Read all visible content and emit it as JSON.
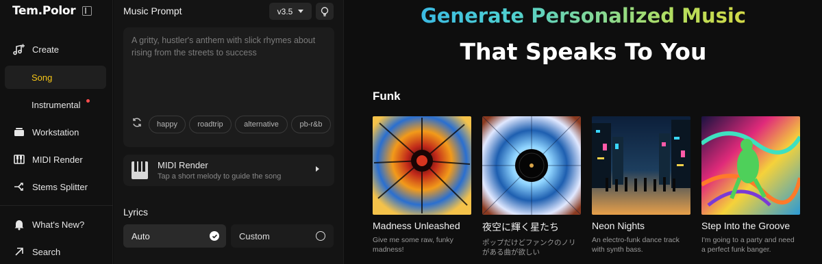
{
  "brand": {
    "name": "Tem.Polor"
  },
  "sidebar": {
    "items": [
      {
        "label": "Create",
        "icon": "music-plus-icon"
      },
      {
        "label": "Song",
        "icon": "",
        "active": true
      },
      {
        "label": "Instrumental",
        "icon": "",
        "badge": "new-dot"
      },
      {
        "label": "Workstation",
        "icon": "workstation-icon"
      },
      {
        "label": "MIDI Render",
        "icon": "piano-keys-icon"
      },
      {
        "label": "Stems Splitter",
        "icon": "split-icon"
      }
    ],
    "bottom": [
      {
        "label": "What's New?",
        "icon": "bell-icon"
      },
      {
        "label": "Search",
        "icon": "arrow-up-right-icon"
      }
    ]
  },
  "prompt": {
    "title": "Music Prompt",
    "version": "v3.5",
    "placeholder": "A gritty, hustler's anthem with slick rhymes about rising from the streets to success",
    "chips": [
      "happy",
      "roadtrip",
      "alternative",
      "pb-r&b"
    ]
  },
  "midi": {
    "title": "MIDI Render",
    "subtitle": "Tap a short melody to guide the song"
  },
  "lyrics": {
    "title": "Lyrics",
    "options": [
      {
        "label": "Auto",
        "selected": true
      },
      {
        "label": "Custom",
        "selected": false
      }
    ]
  },
  "hero": {
    "line1": "Generate Personalized Music",
    "line2": "That Speaks To You"
  },
  "section": {
    "title": "Funk",
    "cards": [
      {
        "title": "Madness Unleashed",
        "desc": "Give me some raw, funky madness!"
      },
      {
        "title": "夜空に輝く星たち",
        "desc": "ポップだけどファンクのノリがある曲が欲しい"
      },
      {
        "title": "Neon Nights",
        "desc": "An electro-funk dance track with synth bass."
      },
      {
        "title": "Step Into the Groove",
        "desc": "I'm going to a party and need a perfect funk banger."
      }
    ]
  },
  "colors": {
    "accent": "#f5c518",
    "gradient": [
      "#2aa7f2",
      "#4fd0d0",
      "#b6de5c",
      "#f2d22e"
    ]
  }
}
